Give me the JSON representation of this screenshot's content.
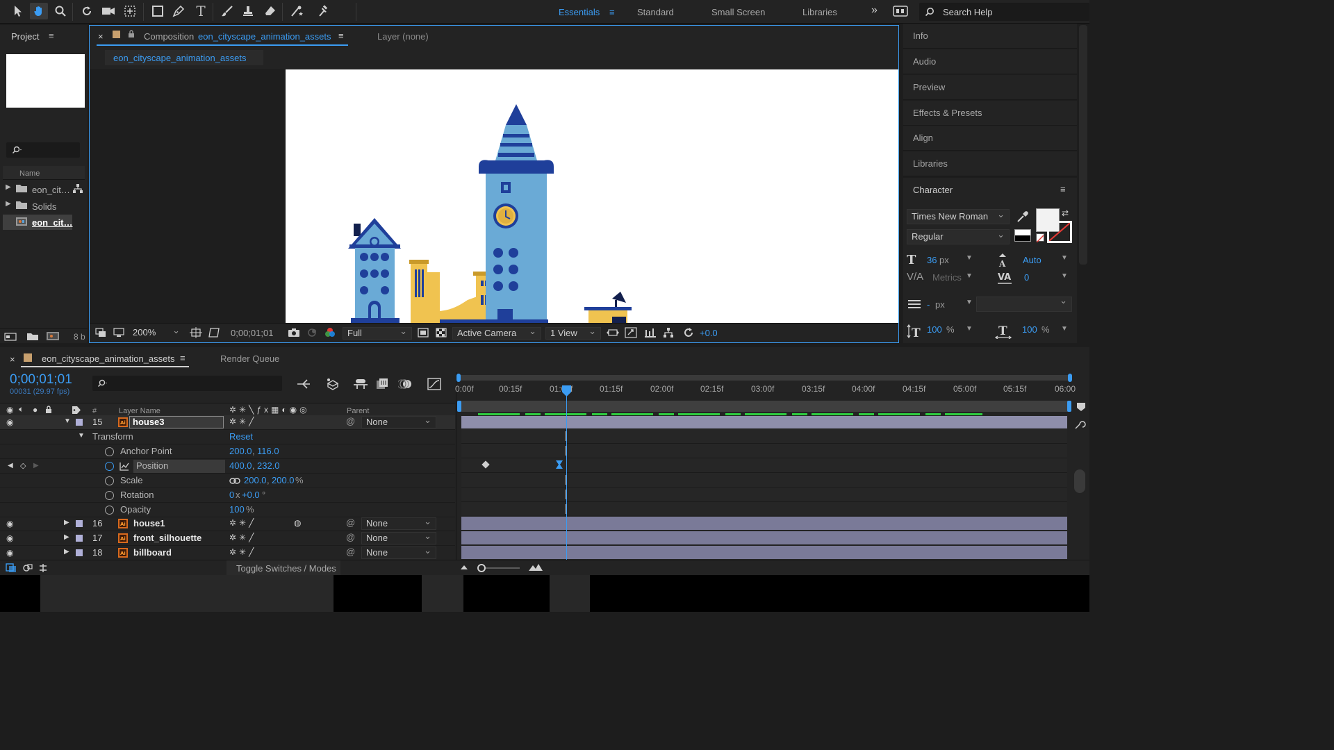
{
  "workspaces": {
    "essentials": "Essentials",
    "standard": "Standard",
    "small_screen": "Small Screen",
    "libraries": "Libraries",
    "search_placeholder": "Search Help"
  },
  "project": {
    "title": "Project",
    "name_header": "Name",
    "items": [
      {
        "label": "eon_cit…"
      },
      {
        "label": "Solids"
      },
      {
        "label": "eon_cit…"
      }
    ],
    "bpc": "8 b"
  },
  "composition": {
    "tab_prefix": "Composition",
    "tab_name": "eon_cityscape_animation_assets",
    "layer_tab": "Layer (none)",
    "sub_tab": "eon_cityscape_animation_assets",
    "zoom": "200%",
    "timecode": "0;00;01;01",
    "resolution": "Full",
    "camera": "Active Camera",
    "views": "1 View",
    "exposure": "+0.0"
  },
  "right_panel": {
    "items": [
      "Info",
      "Audio",
      "Preview",
      "Effects & Presets",
      "Align",
      "Libraries"
    ],
    "character": {
      "title": "Character",
      "font": "Times New Roman",
      "style": "Regular",
      "size": "36",
      "size_unit": "px",
      "leading": "Auto",
      "kerning": "Metrics",
      "tracking": "0",
      "stroke": "-",
      "stroke_unit": "px",
      "vscale": "100",
      "hscale": "100",
      "percent": "%"
    }
  },
  "timeline": {
    "tab": "eon_cityscape_animation_assets",
    "render_queue": "Render Queue",
    "timecode": "0;00;01;01",
    "frame_info": "00031 (29.97 fps)",
    "headers": {
      "hash": "#",
      "layer_name": "Layer Name",
      "parent": "Parent"
    },
    "ruler": [
      "0:00f",
      "00:15f",
      "01:00f",
      "01:15f",
      "02:00f",
      "02:15f",
      "03:00f",
      "03:15f",
      "04:00f",
      "04:15f",
      "05:00f",
      "05:15f",
      "06:00"
    ],
    "layers": [
      {
        "num": "15",
        "name": "house3",
        "parent": "None"
      },
      {
        "num": "16",
        "name": "house1",
        "parent": "None"
      },
      {
        "num": "17",
        "name": "front_silhouette",
        "parent": "None"
      },
      {
        "num": "18",
        "name": "billboard",
        "parent": "None"
      }
    ],
    "transform": {
      "label": "Transform",
      "reset": "Reset",
      "anchor_label": "Anchor Point",
      "anchor_x": "200.0",
      "anchor_y": "116.0",
      "position_label": "Position",
      "position_x": "400.0",
      "position_y": "232.0",
      "scale_label": "Scale",
      "scale_x": "200.0",
      "scale_y": "200.0",
      "scale_unit": "%",
      "rotation_label": "Rotation",
      "rotation_turns": "0",
      "rotation_x": "x",
      "rotation_deg": "+0.0",
      "rotation_unit": "°",
      "opacity_label": "Opacity",
      "opacity": "100",
      "opacity_unit": "%"
    },
    "toggle_label": "Toggle Switches / Modes"
  },
  "colors": {
    "accent": "#3b9cf3",
    "panel": "#232323",
    "layer_bar": "#7a7a98",
    "workarea": "#2ecc40"
  }
}
